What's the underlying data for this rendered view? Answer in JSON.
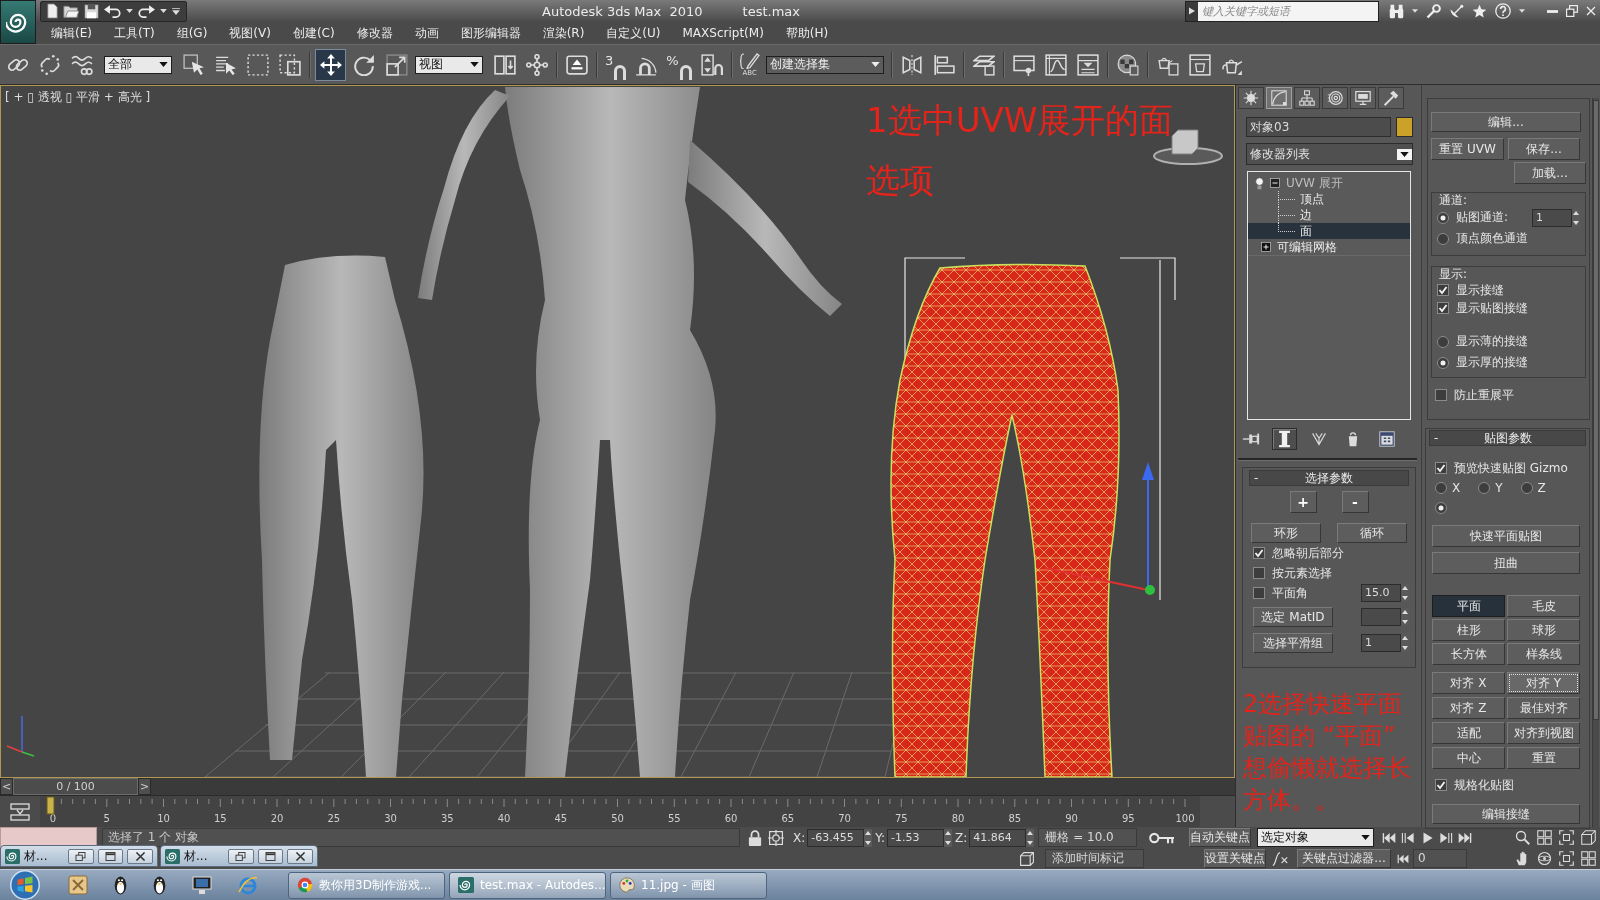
{
  "title_bar": {
    "app_title": "Autodesk 3ds Max  2010",
    "file_name": "test.max",
    "search": {
      "placeholder": "键入关键字或短语"
    }
  },
  "menu_bar": [
    "编辑(E)",
    "工具(T)",
    "组(G)",
    "视图(V)",
    "创建(C)",
    "修改器",
    "动画",
    "图形编辑器",
    "渲染(R)",
    "自定义(U)",
    "MAXScript(M)",
    "帮助(H)"
  ],
  "main_toolbar": {
    "selection_filter": "全部",
    "transform_tools": [
      {
        "kind": "move",
        "selected": true
      },
      {
        "kind": "rotate",
        "selected": false
      },
      {
        "kind": "scale",
        "selected": false
      }
    ],
    "reference_coordinate_system": "视图",
    "snap_dimension": "3",
    "percent_snap_label": "%",
    "edit_named_selection_label": "ABC",
    "named_selection_set": "创建选择集"
  },
  "viewport": {
    "label": "[ + ▯ 透视 ▯ 平滑 + 高光 ]"
  },
  "annotations": [
    {
      "lines": [
        "1选中UVW展开的面",
        "选项"
      ]
    },
    {
      "lines": [
        "2选择快速平面",
        "贴图的 “平面”",
        "想偷懒就选择长",
        "方体。。"
      ]
    }
  ],
  "command_panel": {
    "tabs": [
      {
        "kind": "create",
        "selected": false
      },
      {
        "kind": "modify",
        "selected": true
      },
      {
        "kind": "hierarchy",
        "selected": false
      },
      {
        "kind": "motion",
        "selected": false
      },
      {
        "kind": "display",
        "selected": false
      },
      {
        "kind": "utilities",
        "selected": false
      }
    ],
    "object_name": "对象03",
    "modifier_list": "修改器列表",
    "modifier_stack": [
      {
        "kind": "modifier",
        "label": "UVW 展开",
        "expanded": true,
        "children": [
          {
            "label": "顶点",
            "selected": false
          },
          {
            "label": "边",
            "selected": false
          },
          {
            "label": "面",
            "selected": true
          }
        ]
      },
      {
        "kind": "base_object",
        "label": "可编辑网格",
        "expanded": false
      }
    ],
    "stack_tools": [
      {
        "kind": "pin",
        "on": false
      },
      {
        "kind": "show_end_result",
        "on": true
      },
      {
        "kind": "make_unique",
        "on": false
      },
      {
        "kind": "remove",
        "on": false
      },
      {
        "kind": "configure",
        "on": false
      }
    ],
    "selection_parameters": {
      "toggle": "-",
      "title": "选择参数",
      "grow_buttons": [
        "+",
        "-"
      ],
      "ring_loop_buttons": [
        "环形",
        "循环"
      ],
      "options": [
        {
          "label": "忽略朝后部分",
          "checked": true
        },
        {
          "label": "按元素选择",
          "checked": false
        },
        {
          "label": "平面角",
          "checked": false,
          "spinner": "15.0"
        }
      ],
      "id_rows": [
        {
          "button": "选定 MatID"
        },
        {
          "button": "选择平滑组",
          "spinner": "1"
        }
      ]
    },
    "unwrap_parameters": {
      "edit_button": "编辑...",
      "reset_button": "重置 UVW",
      "save_button": "保存...",
      "load_button": "加载...",
      "channel": {
        "title": "通道:",
        "options": [
          {
            "label": "贴图通道:",
            "selected": true,
            "spinner": "1"
          },
          {
            "label": "顶点颜色通道",
            "selected": false
          }
        ]
      },
      "display": {
        "title": "显示:",
        "seam_checks": [
          {
            "label": "显示接缝",
            "checked": true
          },
          {
            "label": "显示贴图接缝",
            "checked": true
          }
        ],
        "seam_styles": [
          {
            "label": "显示薄的接缝",
            "selected": false
          },
          {
            "label": "显示厚的接缝",
            "selected": true
          }
        ]
      },
      "prevent_reflatten": {
        "label": "防止重展平",
        "checked": false
      }
    },
    "map_parameters": {
      "toggle": "-",
      "title": "贴图参数",
      "preview": {
        "label": "预览快速贴图 Gizmo",
        "checked": true
      },
      "axes": [
        {
          "label": "X",
          "selected": false
        },
        {
          "label": "Y",
          "selected": false
        },
        {
          "label": "Z",
          "selected": false
        }
      ],
      "align_option": {
        "selected": true
      },
      "quick_map_button": "快速平面贴图",
      "twist_button": "扭曲",
      "projections": [
        {
          "label": "平面",
          "selected": true
        },
        {
          "label": "毛皮",
          "selected": false
        },
        {
          "label": "柱形",
          "selected": false
        },
        {
          "label": "球形",
          "selected": false
        },
        {
          "label": "长方体",
          "selected": false
        },
        {
          "label": "样条线",
          "selected": false
        }
      ],
      "align_buttons": [
        {
          "label": "对齐 X",
          "focused": false
        },
        {
          "label": "对齐 Y",
          "focused": true
        },
        {
          "label": "对齐 Z",
          "focused": false
        },
        {
          "label": "最佳对齐",
          "focused": false
        },
        {
          "label": "适配",
          "focused": false
        },
        {
          "label": "对齐到视图",
          "focused": false
        },
        {
          "label": "中心",
          "focused": false
        },
        {
          "label": "重置",
          "focused": false
        }
      ],
      "normalize": {
        "label": "规格化贴图",
        "checked": true
      },
      "edit_seams_button": "编辑接缝"
    }
  },
  "time_slider": {
    "previous": "<",
    "position": "0 / 100",
    "next": ">",
    "level": 0
  },
  "track_bar": {
    "frame_labels": [
      "0",
      "5",
      "10",
      "15",
      "20",
      "25",
      "30",
      "35",
      "40",
      "45",
      "50",
      "55",
      "60",
      "65",
      "70",
      "75",
      "80",
      "85",
      "90",
      "95",
      "100"
    ]
  },
  "status_bar": {
    "message": "选择了 1 个 对象",
    "coordinates": [
      {
        "label": "X:",
        "value": "-63.455"
      },
      {
        "label": "Y:",
        "value": "-1.53"
      },
      {
        "label": "Z:",
        "value": "41.864"
      }
    ],
    "grid": "栅格 = 10.0",
    "time_tag": "添加时间标记",
    "auto_key": "自动关键点",
    "set_key": "设置关键点",
    "key_mode": "选定对象",
    "key_filters": "关键点过滤器...",
    "current_frame": "0"
  },
  "minimized_windows": [
    {
      "title": "材..."
    },
    {
      "title": "材..."
    }
  ],
  "taskbar": {
    "tasks": [
      {
        "kind": "browser",
        "label": "教你用3D制作游戏...",
        "selected": false
      },
      {
        "kind": "max",
        "label": "test.max - Autodes...",
        "selected": true
      },
      {
        "kind": "paint",
        "label": "11.jpg - 画图",
        "selected": false
      }
    ]
  }
}
